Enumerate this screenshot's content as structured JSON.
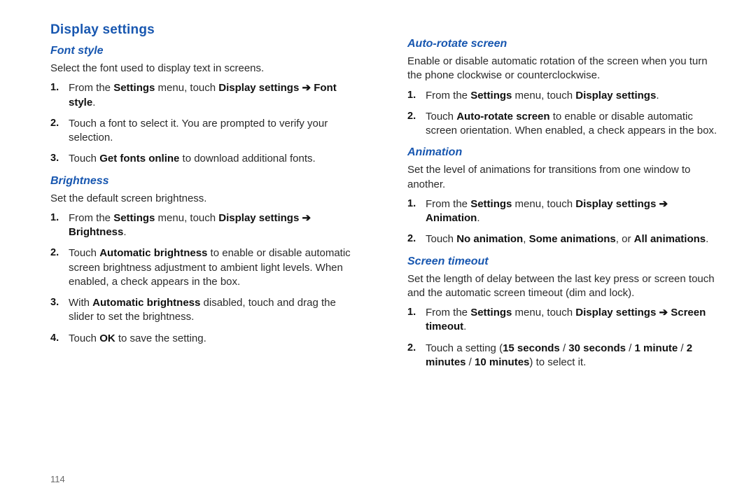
{
  "pageNumber": "114",
  "left": {
    "title": "Display settings",
    "sections": [
      {
        "heading": "Font style",
        "desc": "Select the font used to display text in screens.",
        "steps": [
          {
            "prefix": "From the ",
            "b1": "Settings",
            "mid1": " menu, touch ",
            "b2": "Display settings",
            "arrow": " ➔ ",
            "b3": "Font style",
            "suffix": "."
          },
          {
            "plain": "Touch a font to select it. You are prompted to verify your selection."
          },
          {
            "prefix": "Touch ",
            "b1": "Get fonts online",
            "suffix": " to download additional fonts."
          }
        ]
      },
      {
        "heading": "Brightness",
        "desc": "Set the default screen brightness.",
        "steps": [
          {
            "prefix": "From the ",
            "b1": "Settings",
            "mid1": " menu, touch ",
            "b2": "Display settings",
            "arrow": " ➔ ",
            "b3": "Brightness",
            "suffix": "."
          },
          {
            "prefix": "Touch ",
            "b1": "Automatic brightness",
            "suffix": " to enable or disable automatic screen brightness adjustment to ambient light levels. When enabled, a check appears in the box."
          },
          {
            "prefix": "With ",
            "b1": "Automatic brightness",
            "suffix": " disabled, touch and drag the slider to set the brightness."
          },
          {
            "prefix": "Touch ",
            "b1": "OK",
            "suffix": " to save the setting."
          }
        ]
      }
    ]
  },
  "right": {
    "sections": [
      {
        "heading": "Auto-rotate screen",
        "desc": "Enable or disable automatic rotation of the screen when you turn the phone clockwise or counterclockwise.",
        "steps": [
          {
            "prefix": "From the ",
            "b1": "Settings",
            "mid1": " menu, touch ",
            "b2": "Display settings",
            "suffix": "."
          },
          {
            "prefix": "Touch ",
            "b1": "Auto-rotate screen",
            "suffix": " to enable or disable automatic screen orientation. When enabled, a check appears in the box."
          }
        ]
      },
      {
        "heading": "Animation",
        "desc": "Set the level of animations for transitions from one window to another.",
        "steps": [
          {
            "prefix": "From the ",
            "b1": "Settings",
            "mid1": " menu, touch ",
            "b2": "Display settings",
            "arrow": " ➔ ",
            "b3": "Animation",
            "suffix": "."
          },
          {
            "prefix": "Touch ",
            "b1": "No animation",
            "mid1": ", ",
            "b2": "Some animations",
            "mid2": ", or ",
            "b3": "All animations",
            "suffix": "."
          }
        ]
      },
      {
        "heading": "Screen timeout",
        "desc": "Set the length of delay between the last key press or screen touch and the automatic screen timeout (dim and lock).",
        "steps": [
          {
            "prefix": "From the ",
            "b1": "Settings",
            "mid1": " menu, touch ",
            "b2": "Display settings",
            "arrow": " ➔ ",
            "b3": "Screen timeout",
            "suffix": "."
          },
          {
            "prefix": "Touch a setting (",
            "b1": "15 seconds",
            "mid1": " / ",
            "b2": "30 seconds",
            "mid2": " / ",
            "b3": "1 minute",
            "mid3": " / ",
            "b4": "2 minutes",
            "mid4": " / ",
            "b5": "10 minutes",
            "suffix": ") to select it."
          }
        ]
      }
    ]
  }
}
